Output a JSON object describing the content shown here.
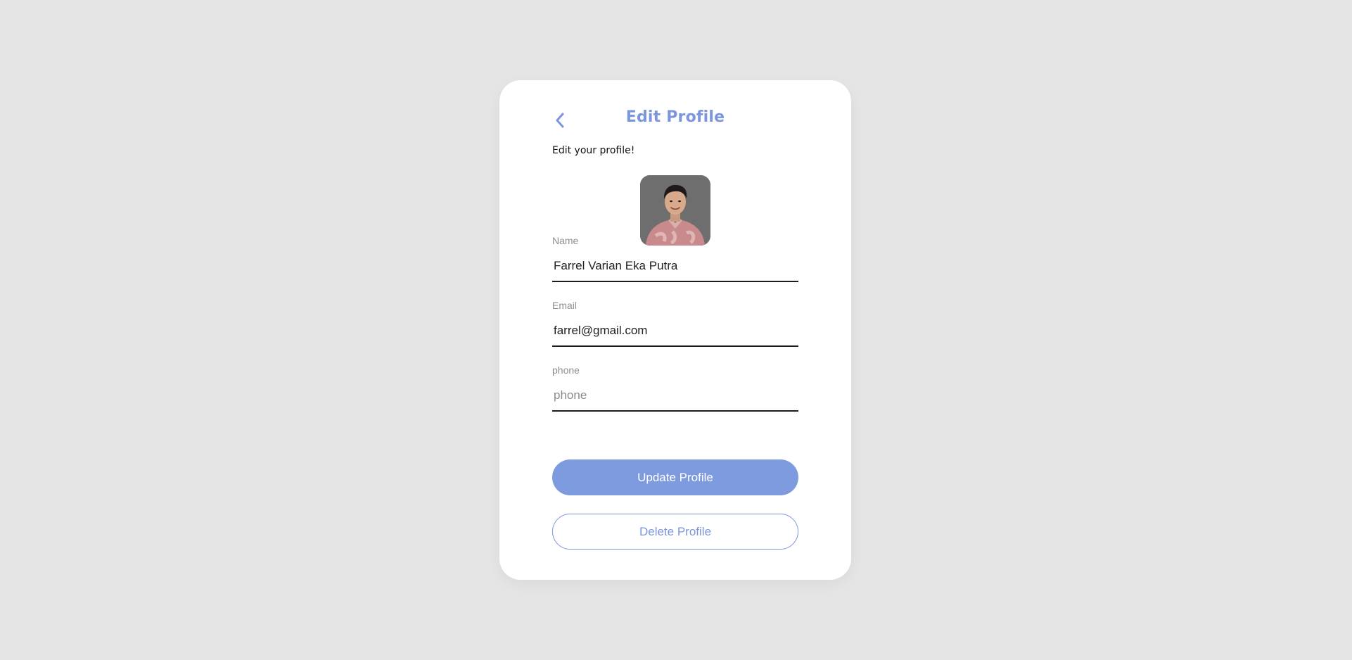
{
  "header": {
    "title": "Edit Profile",
    "back_icon": "chevron-left-icon"
  },
  "subtitle": "Edit your profile!",
  "avatar": {
    "alt": "profile photo"
  },
  "fields": {
    "name": {
      "label": "Name",
      "value": "Farrel Varian Eka Putra",
      "placeholder": ""
    },
    "email": {
      "label": "Email",
      "value": "farrel@gmail.com",
      "placeholder": ""
    },
    "phone": {
      "label": "phone",
      "value": "",
      "placeholder": "phone"
    }
  },
  "buttons": {
    "update_label": "Update Profile",
    "delete_label": "Delete Profile"
  },
  "colors": {
    "accent": "#7b95df",
    "button_fill": "#7e9be0",
    "background": "#e5e5e6",
    "card": "#ffffff"
  }
}
